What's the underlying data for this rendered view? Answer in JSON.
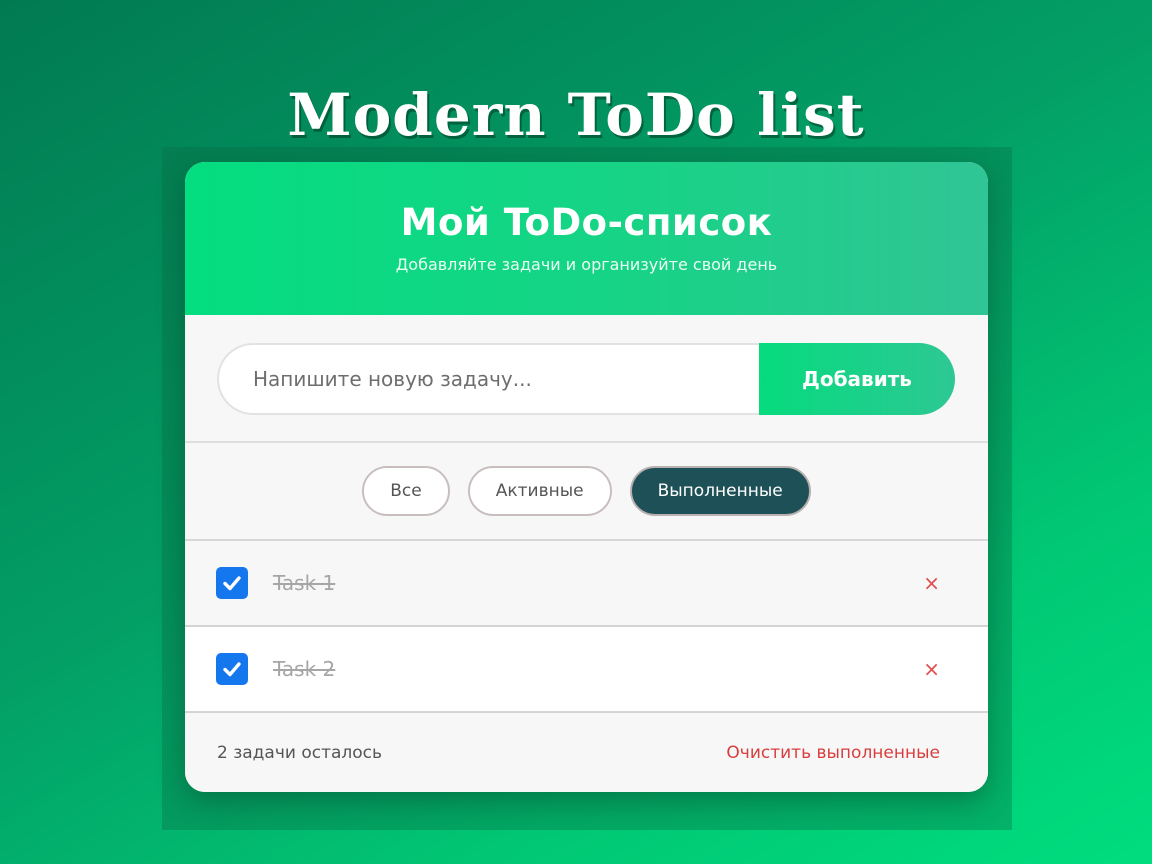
{
  "page": {
    "title": "Modern ToDo list"
  },
  "header": {
    "title": "Мой ToDo-список",
    "subtitle": "Добавляйте задачи и организуйте свой день"
  },
  "input": {
    "placeholder": "Напишите новую задачу...",
    "value": "",
    "add_label": "Добавить"
  },
  "filters": [
    {
      "label": "Все",
      "active": false
    },
    {
      "label": "Активные",
      "active": false
    },
    {
      "label": "Выполненные",
      "active": true
    }
  ],
  "tasks": [
    {
      "text": "Task 1",
      "completed": true,
      "delete_icon": "×"
    },
    {
      "text": "Task 2",
      "completed": true,
      "delete_icon": "×"
    }
  ],
  "footer": {
    "remaining": "2 задачи осталось",
    "clear_label": "Очистить выполненные"
  },
  "icons": {
    "checkbox": "check-icon",
    "delete": "close-icon"
  },
  "colors": {
    "accent": "#04dd80",
    "active_filter": "#1e5157",
    "checkbox": "#1577ee",
    "danger": "#d93d3d"
  }
}
